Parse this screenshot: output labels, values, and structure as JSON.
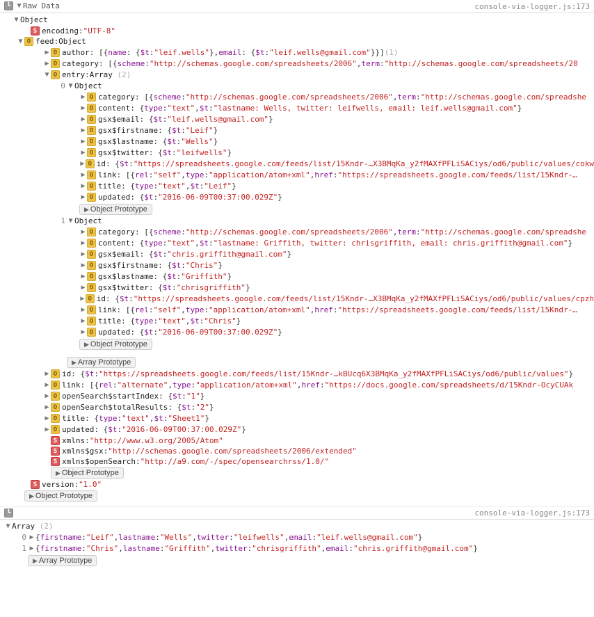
{
  "source": "console-via-logger.js:173",
  "labels": {
    "raw": "Raw Data",
    "array": "Array",
    "object": "Object",
    "objProto": "Object Prototype",
    "arrProto": "Array Prototype"
  },
  "encoding": {
    "key": "encoding",
    "value": "\"UTF-8\""
  },
  "feed": {
    "key": "feed",
    "type": "Object",
    "author": {
      "key": "author",
      "name_t": "\"leif.wells\"",
      "email_t": "\"leif.wells@gmail.com\"",
      "count": "(1)"
    },
    "category": {
      "key": "category",
      "scheme": "\"http://schemas.google.com/spreadsheets/2006\"",
      "term": "\"http://schemas.google.com/spreadsheets/20"
    },
    "entry": {
      "key": "entry",
      "type": "Array",
      "count": "(2)"
    },
    "id": {
      "key": "id",
      "t": "\"https://spreadsheets.google.com/feeds/list/15Kndr-…kBUcq6X3BMqKa_y2fMAXfPFLiSACiys/od6/public/values\""
    },
    "link": {
      "key": "link",
      "rel": "\"alternate\"",
      "type": "\"application/atom+xml\"",
      "href": "\"https://docs.google.com/spreadsheets/d/15Kndr-OcyCUAk"
    },
    "startIndex": {
      "key": "openSearch$startIndex",
      "t": "\"1\""
    },
    "totalResults": {
      "key": "openSearch$totalResults",
      "t": "\"2\""
    },
    "title": {
      "key": "title",
      "type": "\"text\"",
      "t": "\"Sheet1\""
    },
    "updated": {
      "key": "updated",
      "t": "\"2016-06-09T00:37:00.029Z\""
    },
    "xmlns": {
      "key": "xmlns",
      "v": "\"http://www.w3.org/2005/Atom\""
    },
    "xmlnsGsx": {
      "key": "xmlns$gsx",
      "v": "\"http://schemas.google.com/spreadsheets/2006/extended\""
    },
    "xmlnsOpen": {
      "key": "xmlns$openSearch",
      "v": "\"http://a9.com/-/spec/opensearchrss/1.0/\""
    }
  },
  "entries": [
    {
      "idx": "0",
      "category": {
        "key": "category",
        "scheme": "\"http://schemas.google.com/spreadsheets/2006\"",
        "term": "\"http://schemas.google.com/spreadshe"
      },
      "content": {
        "key": "content",
        "type": "\"text\"",
        "t": "\"lastname: Wells, twitter: leifwells, email: leif.wells@gmail.com\""
      },
      "gsxEmail": {
        "key": "gsx$email",
        "t": "\"leif.wells@gmail.com\""
      },
      "gsxFirst": {
        "key": "gsx$firstname",
        "t": "\"Leif\""
      },
      "gsxLast": {
        "key": "gsx$lastname",
        "t": "\"Wells\""
      },
      "gsxTw": {
        "key": "gsx$twitter",
        "t": "\"leifwells\""
      },
      "id": {
        "key": "id",
        "t": "\"https://spreadsheets.google.com/feeds/list/15Kndr-…X3BMqKa_y2fMAXfPFLiSACiys/od6/public/values/cokw"
      },
      "link": {
        "key": "link",
        "rel": "\"self\"",
        "type": "\"application/atom+xml\"",
        "href": "\"https://spreadsheets.google.com/feeds/list/15Kndr-…"
      },
      "title": {
        "key": "title",
        "type": "\"text\"",
        "t": "\"Leif\""
      },
      "updated": {
        "key": "updated",
        "t": "\"2016-06-09T00:37:00.029Z\""
      }
    },
    {
      "idx": "1",
      "category": {
        "key": "category",
        "scheme": "\"http://schemas.google.com/spreadsheets/2006\"",
        "term": "\"http://schemas.google.com/spreadshe"
      },
      "content": {
        "key": "content",
        "type": "\"text\"",
        "t": "\"lastname: Griffith, twitter: chrisgriffith, email: chris.griffith@gmail.com\""
      },
      "gsxEmail": {
        "key": "gsx$email",
        "t": "\"chris.griffith@gmail.com\""
      },
      "gsxFirst": {
        "key": "gsx$firstname",
        "t": "\"Chris\""
      },
      "gsxLast": {
        "key": "gsx$lastname",
        "t": "\"Griffith\""
      },
      "gsxTw": {
        "key": "gsx$twitter",
        "t": "\"chrisgriffith\""
      },
      "id": {
        "key": "id",
        "t": "\"https://spreadsheets.google.com/feeds/list/15Kndr-…X3BMqKa_y2fMAXfPFLiSACiys/od6/public/values/cpzh"
      },
      "link": {
        "key": "link",
        "rel": "\"self\"",
        "type": "\"application/atom+xml\"",
        "href": "\"https://spreadsheets.google.com/feeds/list/15Kndr-…"
      },
      "title": {
        "key": "title",
        "type": "\"text\"",
        "t": "\"Chris\""
      },
      "updated": {
        "key": "updated",
        "t": "\"2016-06-09T00:37:00.029Z\""
      }
    }
  ],
  "version": {
    "key": "version",
    "v": "\"1.0\""
  },
  "arraySummary": {
    "count": "(2)",
    "rows": [
      {
        "idx": "0",
        "firstname": "\"Leif\"",
        "lastname": "\"Wells\"",
        "twitter": "\"leifwells\"",
        "email": "\"leif.wells@gmail.com\""
      },
      {
        "idx": "1",
        "firstname": "\"Chris\"",
        "lastname": "\"Griffith\"",
        "twitter": "\"chrisgriffith\"",
        "email": "\"chris.griffith@gmail.com\""
      }
    ],
    "keys": {
      "firstname": "firstname",
      "lastname": "lastname",
      "twitter": "twitter",
      "email": "email"
    }
  }
}
